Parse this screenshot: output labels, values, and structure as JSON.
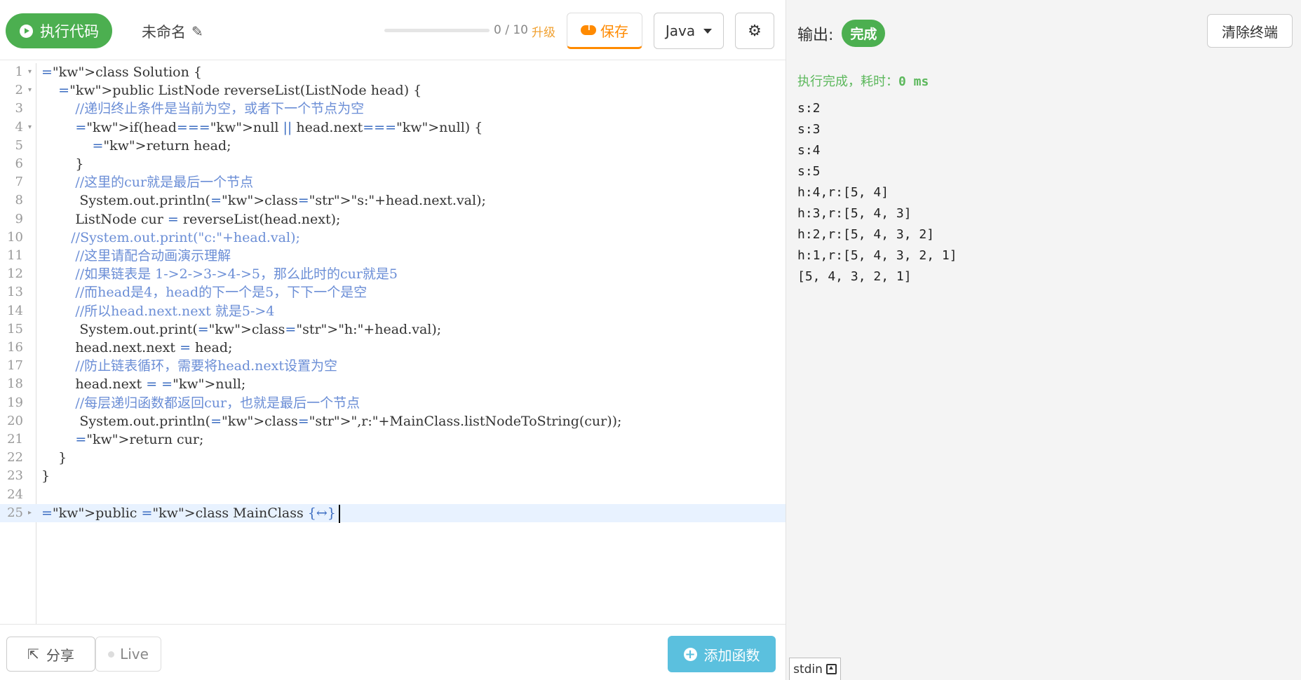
{
  "toolbar": {
    "run_label": "执行代码",
    "title": "未命名",
    "quota": "0 / 10",
    "quota_fraction": 0,
    "upgrade_label": "升级",
    "save_label": "保存",
    "language": "Java"
  },
  "editor": {
    "lines": [
      {
        "n": "1",
        "fold": "▾",
        "text": "class Solution {"
      },
      {
        "n": "2",
        "fold": "▾",
        "text": "    public ListNode reverseList(ListNode head) {"
      },
      {
        "n": "3",
        "fold": "",
        "text": "        //递归终止条件是当前为空，或者下一个节点为空"
      },
      {
        "n": "4",
        "fold": "▾",
        "text": "        if(head==null || head.next==null) {"
      },
      {
        "n": "5",
        "fold": "",
        "text": "            return head;"
      },
      {
        "n": "6",
        "fold": "",
        "text": "        }"
      },
      {
        "n": "7",
        "fold": "",
        "text": "        //这里的cur就是最后一个节点"
      },
      {
        "n": "8",
        "fold": "",
        "text": "         System.out.println(\"s:\"+head.next.val);"
      },
      {
        "n": "9",
        "fold": "",
        "text": "        ListNode cur = reverseList(head.next);"
      },
      {
        "n": "10",
        "fold": "",
        "text": "       //System.out.print(\"c:\"+head.val);"
      },
      {
        "n": "11",
        "fold": "",
        "text": "        //这里请配合动画演示理解"
      },
      {
        "n": "12",
        "fold": "",
        "text": "        //如果链表是 1->2->3->4->5，那么此时的cur就是5"
      },
      {
        "n": "13",
        "fold": "",
        "text": "        //而head是4，head的下一个是5，下下一个是空"
      },
      {
        "n": "14",
        "fold": "",
        "text": "        //所以head.next.next 就是5->4"
      },
      {
        "n": "15",
        "fold": "",
        "text": "         System.out.print(\"h:\"+head.val);"
      },
      {
        "n": "16",
        "fold": "",
        "text": "        head.next.next = head;"
      },
      {
        "n": "17",
        "fold": "",
        "text": "        //防止链表循环，需要将head.next设置为空"
      },
      {
        "n": "18",
        "fold": "",
        "text": "        head.next = null;"
      },
      {
        "n": "19",
        "fold": "",
        "text": "        //每层递归函数都返回cur，也就是最后一个节点"
      },
      {
        "n": "20",
        "fold": "",
        "text": "         System.out.println(\",r:\"+MainClass.listNodeToString(cur));"
      },
      {
        "n": "21",
        "fold": "",
        "text": "        return cur;"
      },
      {
        "n": "22",
        "fold": "",
        "text": "    }"
      },
      {
        "n": "23",
        "fold": "",
        "text": "}"
      },
      {
        "n": "24",
        "fold": "",
        "text": ""
      },
      {
        "n": "25",
        "fold": "▸",
        "text": "public class MainClass {↔}"
      }
    ]
  },
  "bottom": {
    "share_label": "分享",
    "live_label": "Live",
    "add_function_label": "添加函数"
  },
  "output": {
    "header_label": "输出:",
    "status_badge": "完成",
    "clear_label": "清除终端",
    "status_text": "执行完成，耗时：",
    "status_time": "0 ms",
    "lines": [
      "s:2",
      "s:3",
      "s:4",
      "s:5",
      "h:4,r:[5, 4]",
      "h:3,r:[5, 4, 3]",
      "h:2,r:[5, 4, 3, 2]",
      "h:1,r:[5, 4, 3, 2, 1]",
      "[5, 4, 3, 2, 1]"
    ],
    "stdin_label": "stdin"
  },
  "colors": {
    "run_green": "#4caf50",
    "save_orange": "#ff8a00",
    "add_blue": "#5bc0de",
    "keyword_blue": "#3b6cc1",
    "comment_blue": "#6b8ed6"
  },
  "icons": [
    "play-icon",
    "pencil-icon",
    "cloud-upload-icon",
    "caret-down-icon",
    "gear-icon",
    "share-icon",
    "live-dot-icon",
    "plus-circle-icon",
    "stdin-toggle-icon"
  ]
}
